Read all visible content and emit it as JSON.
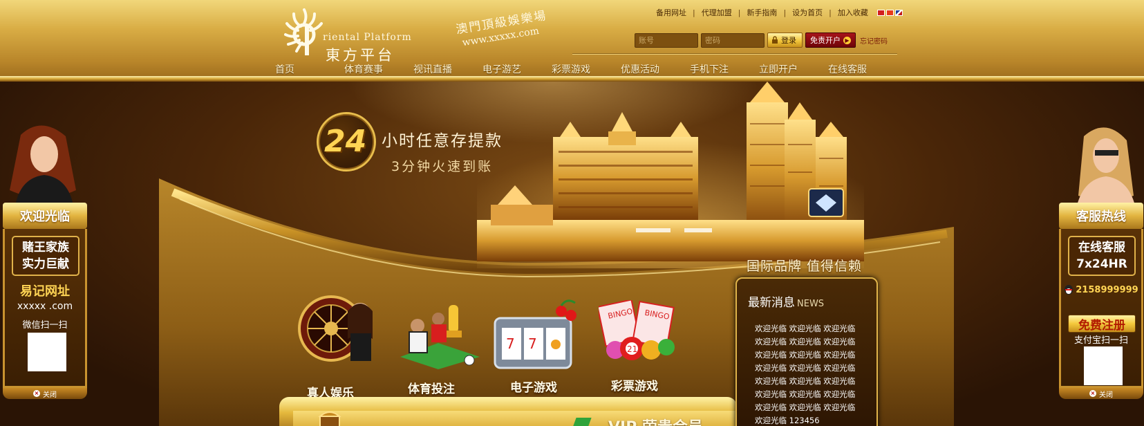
{
  "header": {
    "logo_en": "riental   Platform",
    "logo_cn": "東方平台",
    "slogan_cn": "澳門頂級娛樂場",
    "slogan_url": "www.xxxxx.com",
    "top_links": [
      "备用网址",
      "代理加盟",
      "新手指南",
      "设为首页",
      "加入收藏"
    ],
    "login": {
      "username_placeholder": "账号",
      "password_placeholder": "密码",
      "login_label": "登录",
      "register_label": "免责开户",
      "forgot_label": "忘记密码"
    },
    "nav": [
      "首页",
      "体育赛事",
      "视讯直播",
      "电子游艺",
      "彩票游戏",
      "优惠活动",
      "手机下注",
      "立即开户",
      "在线客服"
    ]
  },
  "banner": {
    "badge_number": "24",
    "promo_line1": "小时任意存提款",
    "promo_line2": "3分钟火速到账",
    "brand_slogan": "国际品牌 值得信赖"
  },
  "games": [
    {
      "label": "真人娱乐",
      "icon": "roulette-icon"
    },
    {
      "label": "体育投注",
      "icon": "soccer-icon"
    },
    {
      "label": "电子游戏",
      "icon": "slot-machine-icon"
    },
    {
      "label": "彩票游戏",
      "icon": "bingo-icon"
    }
  ],
  "news": {
    "title": "最新消息",
    "title_en": "NEWS",
    "items": [
      "欢迎光临 欢迎光临 欢迎光临",
      "欢迎光临 欢迎光临 欢迎光临",
      "欢迎光临 欢迎光临 欢迎光临",
      "欢迎光临 欢迎光临 欢迎光临",
      "欢迎光临 欢迎光临 欢迎光临",
      "欢迎光临 欢迎光临 欢迎光临",
      "欢迎光临 欢迎光临 欢迎光临",
      "欢迎光临 123456"
    ]
  },
  "vip": {
    "text": "VIP 萤贵会员"
  },
  "left_float": {
    "head": "欢迎光临",
    "box_line1": "赌王家族",
    "box_line2": "实力巨献",
    "remember_url": "易记网址",
    "url": "xxxxx .com",
    "wechat_label": "微信扫一扫",
    "close_label": "关闭"
  },
  "right_float": {
    "head": "客服热线",
    "box_line1": "在线客服",
    "box_line2": "7x24HR",
    "qq": "2158999999",
    "free_register": "免费注册",
    "alipay_label": "支付宝扫一扫",
    "close_label": "关闭"
  },
  "colors": {
    "header_gold": "#d9ad45",
    "bg_brown": "#2a1405",
    "accent_red": "#a7141a"
  }
}
